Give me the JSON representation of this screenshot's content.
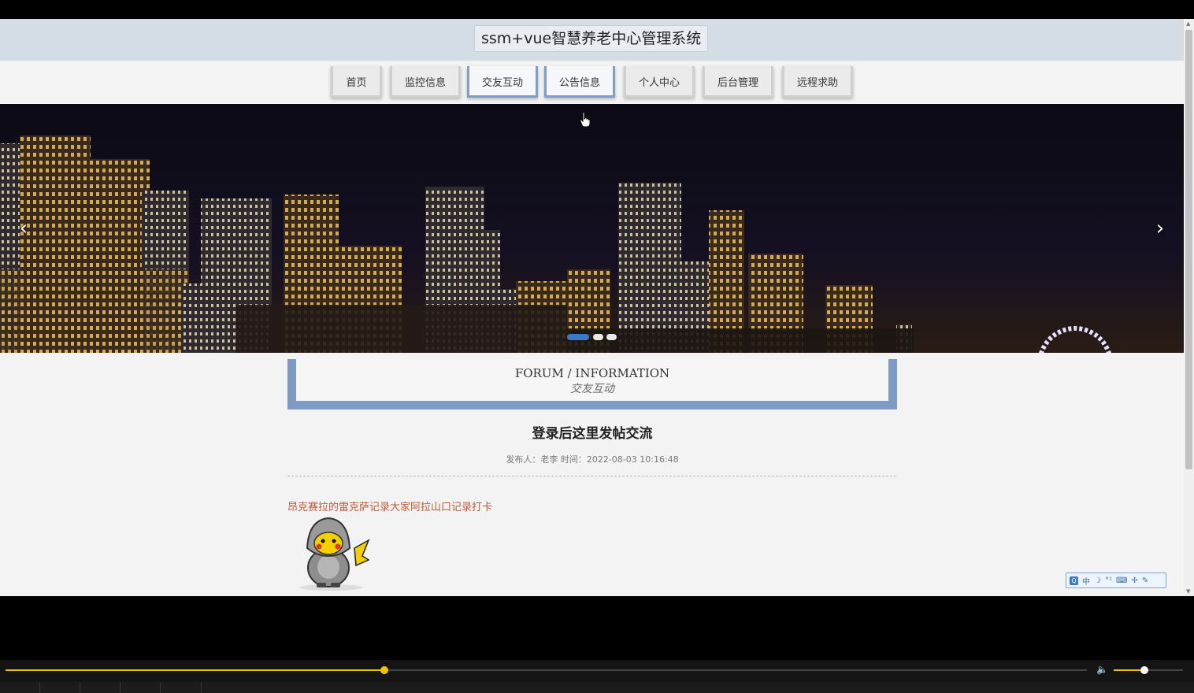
{
  "site": {
    "title": "ssm+vue智慧养老中心管理系统"
  },
  "nav": {
    "items": [
      {
        "label": "首页",
        "active": false
      },
      {
        "label": "监控信息",
        "active": false
      },
      {
        "label": "交友互动",
        "active": true
      },
      {
        "label": "公告信息",
        "active": true
      },
      {
        "label": "个人中心",
        "active": false
      },
      {
        "label": "后台管理",
        "active": false
      },
      {
        "label": "远程求助",
        "active": false
      }
    ]
  },
  "banner": {
    "prev_icon": "chevron-left-icon",
    "next_icon": "chevron-right-icon",
    "prev_glyph": "‹",
    "next_glyph": "›",
    "slide_count": 3,
    "active_slide": 1
  },
  "section": {
    "title_en": "FORUM / INFORMATION",
    "title_cn": "交友互动"
  },
  "post": {
    "title": "登录后这里发帖交流",
    "meta": "发布人：老李 时间：2022-08-03 10:16:48",
    "body": "昂克赛拉的雷克萨记录大家阿拉山口记录打卡",
    "image_icon": "pikachu-sticker-icon"
  },
  "ime": {
    "items": [
      "中",
      "☽",
      "°¹",
      "⌨",
      "✢",
      "✎"
    ]
  },
  "player": {
    "progress_fraction": 0.35,
    "volume_fraction": 0.44
  },
  "colors": {
    "accent": "#7f9bc5",
    "header_bg": "#d4dde5",
    "post_body": "#c05a3a",
    "seek": "#e8c000"
  }
}
